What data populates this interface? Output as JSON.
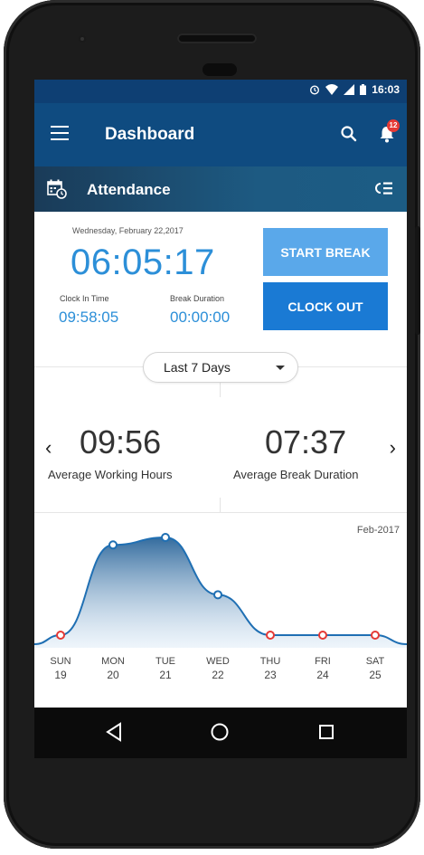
{
  "status_bar": {
    "time": "16:03"
  },
  "app_bar": {
    "title": "Dashboard",
    "notification_count": "12"
  },
  "section": {
    "title": "Attendance"
  },
  "summary": {
    "date": "Wednesday, February 22,2017",
    "current_time": "06:05:17",
    "clock_in_label": "Clock In Time",
    "clock_in_value": "09:58:05",
    "break_label": "Break Duration",
    "break_value": "00:00:00"
  },
  "actions": {
    "start_break": "START BREAK",
    "clock_out": "CLOCK OUT"
  },
  "range": {
    "selected": "Last 7 Days"
  },
  "stats": {
    "avg_working_value": "09:56",
    "avg_working_label": "Average Working Hours",
    "avg_break_value": "07:37",
    "avg_break_label": "Average Break Duration"
  },
  "colors": {
    "primary": "#0f4b80",
    "accent": "#2c8fd8",
    "button_light": "#5aa8ea",
    "button_dark": "#1a7ad4",
    "zero_marker": "#e53935"
  },
  "chart_data": {
    "type": "area",
    "title": "Feb-2017",
    "categories": [
      "SUN",
      "MON",
      "TUE",
      "WED",
      "THU",
      "FRI",
      "SAT"
    ],
    "dates": [
      "19",
      "20",
      "21",
      "22",
      "23",
      "24",
      "25"
    ],
    "values": [
      0,
      9.6,
      10.4,
      4.3,
      0,
      0,
      0
    ]
  }
}
